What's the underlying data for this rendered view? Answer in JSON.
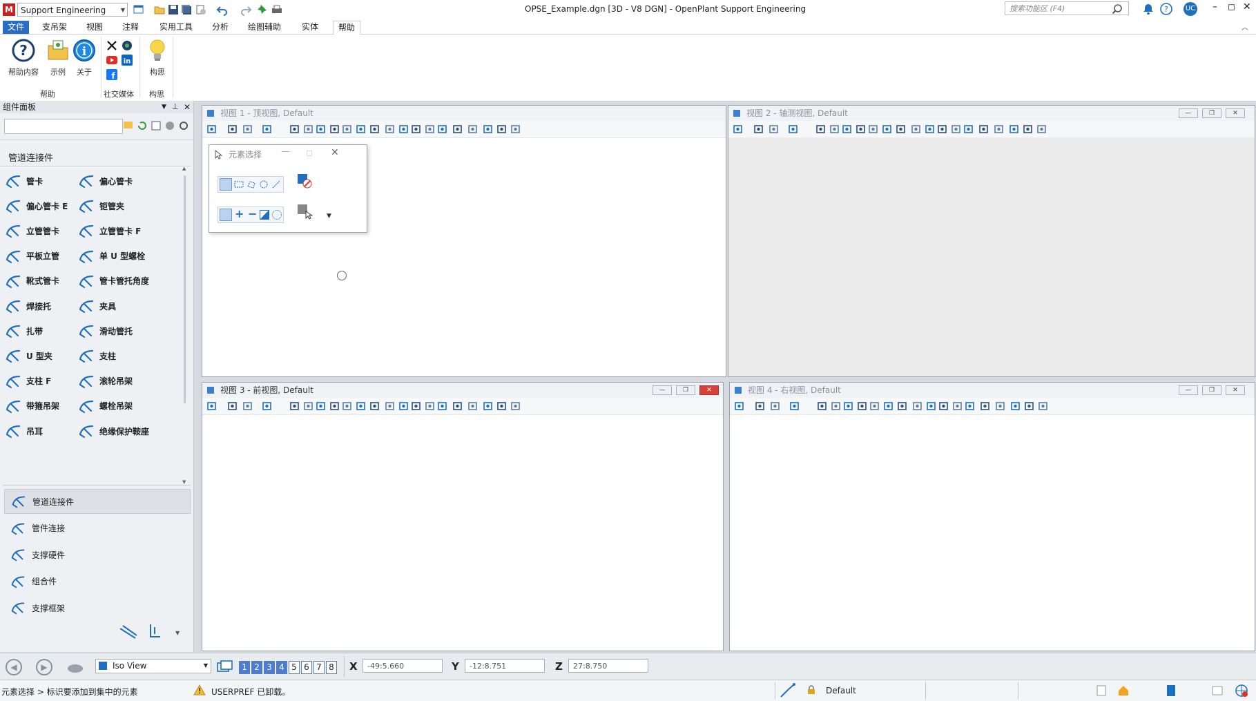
{
  "title_bar": {
    "workspace": "Support Engineering",
    "document_title": "OPSE_Example.dgn [3D - V8 DGN] - OpenPlant Support Engineering",
    "search_placeholder": "搜索功能区 (F4)",
    "user_initials": "UC",
    "logo_text": "M"
  },
  "menu": {
    "items": [
      "文件",
      "支吊架",
      "视图",
      "注释",
      "实用工具",
      "分析",
      "绘图辅助",
      "实体",
      "帮助"
    ],
    "active": "帮助"
  },
  "ribbon": {
    "help_group": {
      "label": "帮助",
      "buttons": [
        "帮助内容",
        "示例",
        "关于"
      ]
    },
    "social_group": {
      "label": "社交媒体",
      "icons": [
        "x-icon",
        "community-icon",
        "youtube-icon",
        "linkedin-icon",
        "facebook-icon"
      ]
    },
    "ideas_group": {
      "label": "构思",
      "buttons": [
        "构思"
      ]
    }
  },
  "panel": {
    "title": "组件面板",
    "category_title": "管道连接件",
    "grid_items": [
      [
        "管卡",
        "偏心管卡"
      ],
      [
        "偏心管卡 E",
        "钜管夹"
      ],
      [
        "立管管卡",
        "立管管卡 F"
      ],
      [
        "平板立管",
        "单 U 型螺栓"
      ],
      [
        "靴式管卡",
        "管卡管托角度"
      ],
      [
        "焊接托",
        "夹具"
      ],
      [
        "扎带",
        "滑动管托"
      ],
      [
        "U 型夹",
        "支柱"
      ],
      [
        "支柱 F",
        "滚轮吊架"
      ],
      [
        "带箍吊架",
        "螺栓吊架"
      ],
      [
        "吊耳",
        "绝缘保护鞍座"
      ]
    ],
    "categories": [
      "管道连接件",
      "管件连接",
      "支撑硬件",
      "组合件",
      "支撑框架"
    ],
    "selected_category": "管道连接件"
  },
  "views": [
    {
      "title": "视图 1 - 顶视图, Default",
      "active": false
    },
    {
      "title": "视图 2 - 轴测视图, Default",
      "active": false
    },
    {
      "title": "视图 3 - 前视图, Default",
      "active": true
    },
    {
      "title": "视图 4 - 右视图, Default",
      "active": false
    }
  ],
  "selection_dialog": {
    "title": "元素选择"
  },
  "status_bar": {
    "view_name": "Iso View",
    "view_numbers": [
      "1",
      "2",
      "3",
      "4",
      "5",
      "6",
      "7",
      "8"
    ],
    "active_view_numbers": [
      "1",
      "2",
      "3",
      "4"
    ],
    "x_label": "X",
    "x_value": "-49:5.660",
    "y_label": "Y",
    "y_value": "-12:8.751",
    "z_label": "Z",
    "z_value": "27:8.750",
    "prompt": "元素选择 > 标识要添加到集中的元素",
    "message": "USERPREF 已卸载。",
    "level": "Default"
  },
  "colors": {
    "accent": "#2b6cc4",
    "view_close_red": "#d8403a",
    "icon_blue": "#1e6fc0"
  }
}
